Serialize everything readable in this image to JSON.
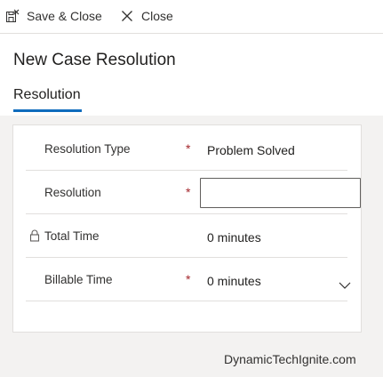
{
  "toolbar": {
    "save_close_label": "Save & Close",
    "close_label": "Close"
  },
  "header": {
    "title": "New Case Resolution",
    "tab_label": "Resolution"
  },
  "form": {
    "fields": [
      {
        "label": "Resolution Type",
        "required": "*",
        "value": "Problem Solved"
      },
      {
        "label": "Resolution",
        "required": "*",
        "value": ""
      },
      {
        "label": "Total Time",
        "required": "",
        "value": "0 minutes",
        "locked": true
      },
      {
        "label": "Billable Time",
        "required": "*",
        "value": "0 minutes",
        "dropdown": true
      }
    ]
  },
  "watermark": "DynamicTechIgnite.com",
  "colors": {
    "accent": "#0f6cbd",
    "required": "#a4262c",
    "background": "#f3f2f1"
  },
  "icons": [
    "save-and-close-icon",
    "close-icon",
    "lock-icon",
    "chevron-down-icon"
  ]
}
